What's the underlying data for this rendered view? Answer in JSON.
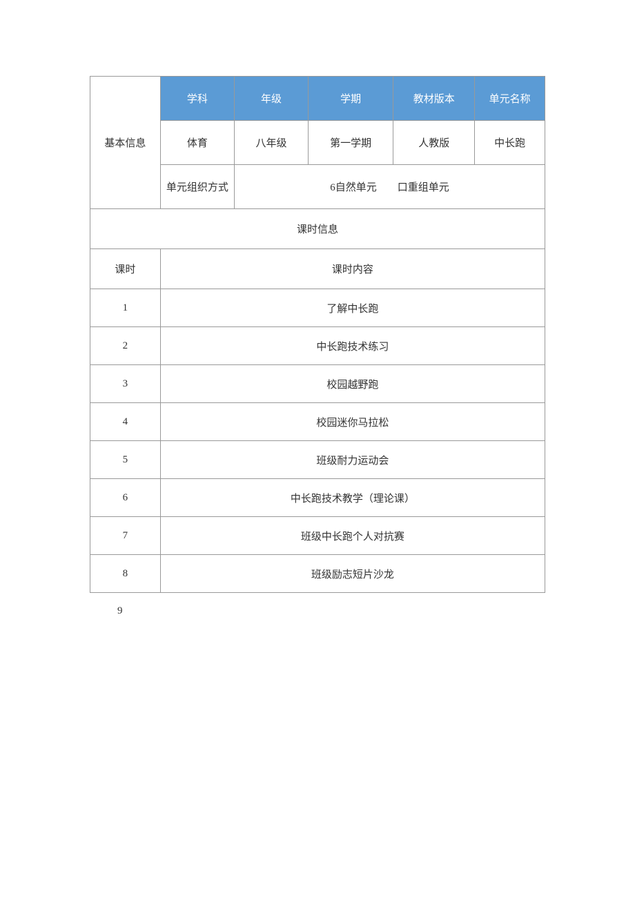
{
  "basicInfo": {
    "label": "基本信息",
    "headers": {
      "subject": "学科",
      "grade": "年级",
      "semester": "学期",
      "version": "教材版本",
      "unitName": "单元名称"
    },
    "values": {
      "subject": "体育",
      "grade": "八年级",
      "semester": "第一学期",
      "version": "人教版",
      "unitName": "中长跑"
    },
    "orgMethod": {
      "label": "单元组织方式",
      "value": "6自然单元　　口重组单元"
    }
  },
  "lessonSection": {
    "title": "课时信息",
    "headers": {
      "lesson": "课时",
      "content": "课时内容"
    },
    "rows": [
      {
        "num": "1",
        "content": "了解中长跑"
      },
      {
        "num": "2",
        "content": "中长跑技术练习"
      },
      {
        "num": "3",
        "content": "校园越野跑"
      },
      {
        "num": "4",
        "content": "校园迷你马拉松"
      },
      {
        "num": "5",
        "content": "班级耐力运动会"
      },
      {
        "num": "6",
        "content": "中长跑技术教学（理论课）"
      },
      {
        "num": "7",
        "content": "班级中长跑个人对抗赛"
      },
      {
        "num": "8",
        "content": "班级励志短片沙龙"
      }
    ]
  },
  "footerNum": "9"
}
